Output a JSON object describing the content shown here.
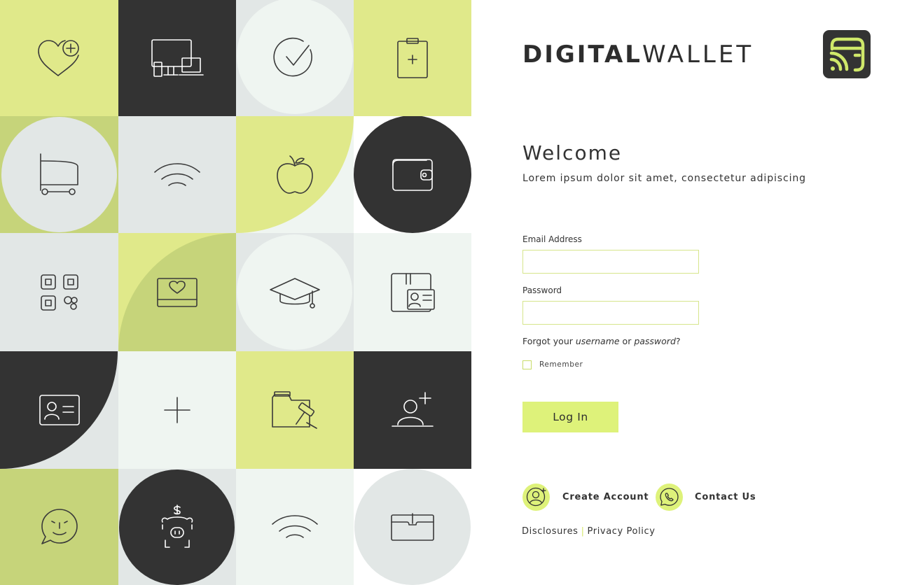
{
  "brand": {
    "bold": "DIGITAL",
    "light": "WALLET"
  },
  "welcome": {
    "title": "Welcome",
    "subtitle": "Lorem ipsum dolor sit amet, consectetur adipiscing"
  },
  "form": {
    "email_label": "Email Address",
    "email_value": "",
    "password_label": "Password",
    "password_value": "",
    "forgot_prefix": "Forgot your ",
    "forgot_username": "username",
    "forgot_or": " or ",
    "forgot_password": "password",
    "forgot_suffix": "?",
    "remember_label": "Remember",
    "remember_checked": false,
    "login_label": "Log In"
  },
  "links": {
    "create_account": "Create Account",
    "contact_us": "Contact Us",
    "disclosures": "Disclosures",
    "separator": "|",
    "privacy_policy": "Privacy Policy"
  },
  "colors": {
    "lime": "#def27a",
    "lime_tile": "#e0e98a",
    "olive_tile": "#c6d47a",
    "dark": "#333333",
    "pale_gray": "#e2e7e6",
    "pale_mint": "#eff5f1",
    "input_border": "#d6e58c"
  },
  "mosaic_icons": [
    "heart-plus-icon",
    "devices-icon",
    "check-circle-icon",
    "clipboard-plus-icon",
    "shopping-cart-icon",
    "wifi-signal-icon",
    "apple-icon",
    "wallet-icon",
    "qr-grid-icon",
    "laptop-heart-icon",
    "graduation-cap-icon",
    "id-folder-icon",
    "id-card-icon",
    "plus-icon",
    "legal-folder-icon",
    "add-user-icon",
    "chat-smile-icon",
    "piggy-bank-icon",
    "wifi-signal-icon",
    "document-folder-icon"
  ]
}
